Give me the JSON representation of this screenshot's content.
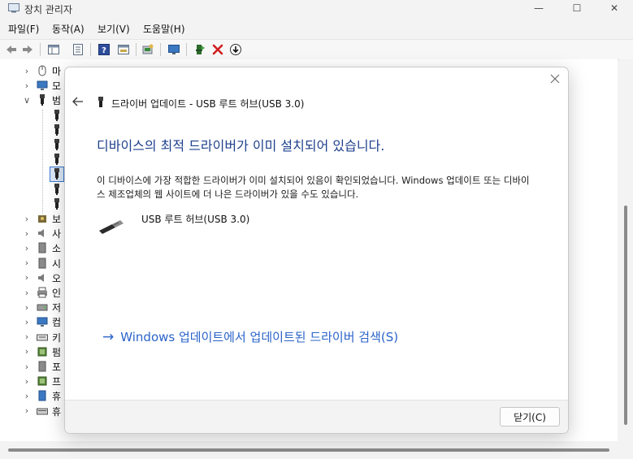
{
  "window": {
    "title": "장치 관리자",
    "minimize": "—",
    "maximize": "☐",
    "close": "✕"
  },
  "menu": {
    "items": [
      "파일(F)",
      "동작(A)",
      "보기(V)",
      "도움말(H)"
    ]
  },
  "toolbar": {
    "icons": [
      "back-icon",
      "forward-icon",
      "properties-pane-icon",
      "list-icon",
      "help-icon",
      "view-icon",
      "scan-hardware-icon",
      "monitor-icon",
      "enable-device-icon",
      "uninstall-icon",
      "update-driver-icon"
    ]
  },
  "tree": {
    "items": [
      {
        "label": "마",
        "expanded": false,
        "icon": "mouse-icon"
      },
      {
        "label": "모",
        "expanded": false,
        "icon": "monitor-icon"
      },
      {
        "label": "범",
        "expanded": true,
        "icon": "usb-icon"
      },
      {
        "label": "",
        "icon": "usb-plug-icon"
      },
      {
        "label": "",
        "icon": "usb-plug-icon"
      },
      {
        "label": "",
        "icon": "usb-plug-icon"
      },
      {
        "label": "",
        "icon": "usb-plug-icon"
      },
      {
        "label": "",
        "icon": "usb-plug-icon",
        "selected": true
      },
      {
        "label": "",
        "icon": "usb-plug-icon"
      },
      {
        "label": "",
        "icon": "usb-plug-icon"
      },
      {
        "label": "보",
        "expanded": false,
        "icon": "security-icon"
      },
      {
        "label": "사",
        "expanded": false,
        "icon": "audio-icon"
      },
      {
        "label": "소",
        "expanded": false,
        "icon": "software-icon"
      },
      {
        "label": "시",
        "expanded": false,
        "icon": "system-icon"
      },
      {
        "label": "오",
        "expanded": false,
        "icon": "speaker-icon"
      },
      {
        "label": "인",
        "expanded": false,
        "icon": "printer-icon"
      },
      {
        "label": "저",
        "expanded": false,
        "icon": "storage-icon"
      },
      {
        "label": "컴",
        "expanded": false,
        "icon": "computer-icon"
      },
      {
        "label": "키",
        "expanded": false,
        "icon": "keyboard-icon"
      },
      {
        "label": "펌",
        "expanded": false,
        "icon": "firmware-icon"
      },
      {
        "label": "포",
        "expanded": false,
        "icon": "port-icon"
      },
      {
        "label": "프",
        "expanded": false,
        "icon": "processor-icon"
      },
      {
        "label": "휴",
        "expanded": false,
        "icon": "portable-icon"
      },
      {
        "label": "휴",
        "expanded": false,
        "icon": "hid-icon"
      }
    ]
  },
  "dialog": {
    "header_title": "드라이버 업데이트 - USB 루트 허브(USB 3.0)",
    "heading": "디바이스의 최적 드라이버가 이미 설치되어 있습니다.",
    "description": "이 디바이스에 가장 적합한 드라이버가 이미 설치되어 있음이 확인되었습니다. Windows 업데이트 또는 디바이스 제조업체의 웹 사이트에 더 나은 드라이버가 있을 수도 있습니다.",
    "device_name": "USB 루트 허브(USB 3.0)",
    "search_link": "Windows 업데이트에서 업데이트된 드라이버 검색(S)",
    "close_button": "닫기(C)",
    "link_color": "#2a63c9",
    "heading_color": "#1e3f8c"
  }
}
